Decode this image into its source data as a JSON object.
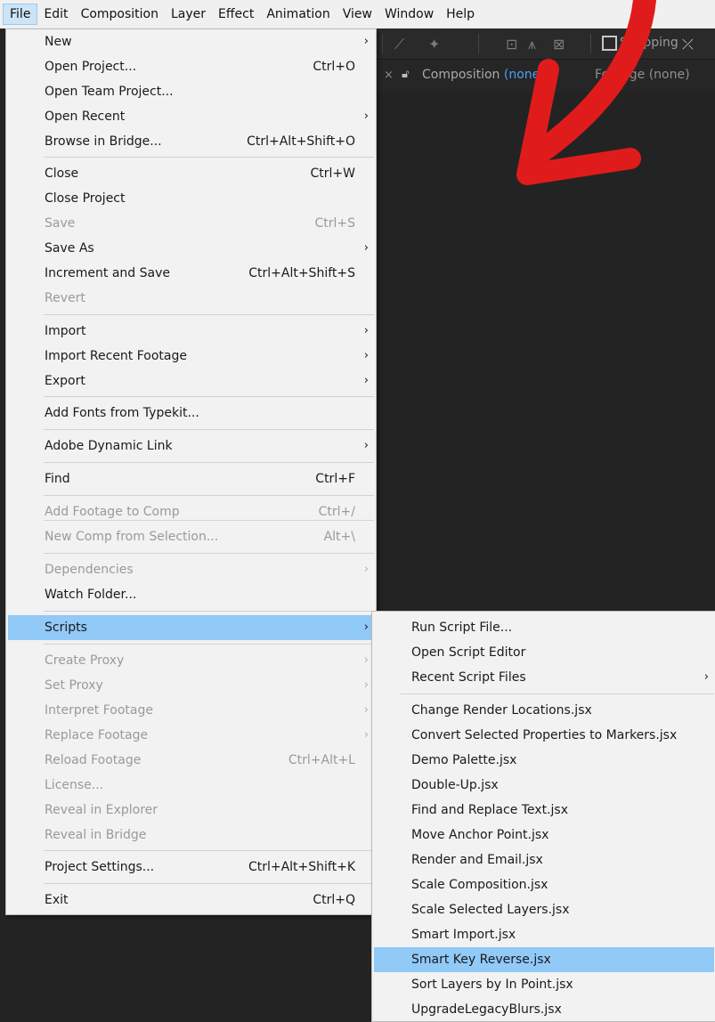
{
  "menubar": {
    "items": [
      "File",
      "Edit",
      "Composition",
      "Layer",
      "Effect",
      "Animation",
      "View",
      "Window",
      "Help"
    ]
  },
  "toolbar": {
    "snapping_label": "Snapping"
  },
  "panel": {
    "composition_tab": "Composition",
    "composition_value": "(none)",
    "footage_tab": "Footage (none)"
  },
  "file_menu": {
    "items": [
      {
        "label": "New",
        "shortcut": "",
        "submenu": true,
        "disabled": false
      },
      {
        "label": "Open Project...",
        "shortcut": "Ctrl+O",
        "submenu": false,
        "disabled": false
      },
      {
        "label": "Open Team Project...",
        "shortcut": "",
        "submenu": false,
        "disabled": false
      },
      {
        "label": "Open Recent",
        "shortcut": "",
        "submenu": true,
        "disabled": false
      },
      {
        "label": "Browse in Bridge...",
        "shortcut": "Ctrl+Alt+Shift+O",
        "submenu": false,
        "disabled": false
      },
      {
        "label": "Close",
        "shortcut": "Ctrl+W",
        "submenu": false,
        "disabled": false
      },
      {
        "label": "Close Project",
        "shortcut": "",
        "submenu": false,
        "disabled": false
      },
      {
        "label": "Save",
        "shortcut": "Ctrl+S",
        "submenu": false,
        "disabled": true
      },
      {
        "label": "Save As",
        "shortcut": "",
        "submenu": true,
        "disabled": false
      },
      {
        "label": "Increment and Save",
        "shortcut": "Ctrl+Alt+Shift+S",
        "submenu": false,
        "disabled": false
      },
      {
        "label": "Revert",
        "shortcut": "",
        "submenu": false,
        "disabled": true
      },
      {
        "label": "Import",
        "shortcut": "",
        "submenu": true,
        "disabled": false
      },
      {
        "label": "Import Recent Footage",
        "shortcut": "",
        "submenu": true,
        "disabled": false
      },
      {
        "label": "Export",
        "shortcut": "",
        "submenu": true,
        "disabled": false
      },
      {
        "label": "Add Fonts from Typekit...",
        "shortcut": "",
        "submenu": false,
        "disabled": false
      },
      {
        "label": "Adobe Dynamic Link",
        "shortcut": "",
        "submenu": true,
        "disabled": false
      },
      {
        "label": "Find",
        "shortcut": "Ctrl+F",
        "submenu": false,
        "disabled": false
      },
      {
        "label": "Add Footage to Comp",
        "shortcut": "Ctrl+/",
        "submenu": false,
        "disabled": true
      },
      {
        "label": "New Comp from Selection...",
        "shortcut": "Alt+\\",
        "submenu": false,
        "disabled": true
      },
      {
        "label": "Dependencies",
        "shortcut": "",
        "submenu": true,
        "disabled": true
      },
      {
        "label": "Watch Folder...",
        "shortcut": "",
        "submenu": false,
        "disabled": false
      },
      {
        "label": "Scripts",
        "shortcut": "",
        "submenu": true,
        "disabled": false,
        "highlighted": true
      },
      {
        "label": "Create Proxy",
        "shortcut": "",
        "submenu": true,
        "disabled": true
      },
      {
        "label": "Set Proxy",
        "shortcut": "",
        "submenu": true,
        "disabled": true
      },
      {
        "label": "Interpret Footage",
        "shortcut": "",
        "submenu": true,
        "disabled": true
      },
      {
        "label": "Replace Footage",
        "shortcut": "",
        "submenu": true,
        "disabled": true
      },
      {
        "label": "Reload Footage",
        "shortcut": "Ctrl+Alt+L",
        "submenu": false,
        "disabled": true
      },
      {
        "label": "License...",
        "shortcut": "",
        "submenu": false,
        "disabled": true
      },
      {
        "label": "Reveal in Explorer",
        "shortcut": "",
        "submenu": false,
        "disabled": true
      },
      {
        "label": "Reveal in Bridge",
        "shortcut": "",
        "submenu": false,
        "disabled": true
      },
      {
        "label": "Project Settings...",
        "shortcut": "Ctrl+Alt+Shift+K",
        "submenu": false,
        "disabled": false
      },
      {
        "label": "Exit",
        "shortcut": "Ctrl+Q",
        "submenu": false,
        "disabled": false
      }
    ]
  },
  "scripts_menu": {
    "items": [
      {
        "label": "Run Script File...",
        "submenu": false
      },
      {
        "label": "Open Script Editor",
        "submenu": false
      },
      {
        "label": "Recent Script Files",
        "submenu": true
      },
      {
        "label": "Change Render Locations.jsx",
        "submenu": false
      },
      {
        "label": "Convert Selected Properties to Markers.jsx",
        "submenu": false
      },
      {
        "label": "Demo Palette.jsx",
        "submenu": false
      },
      {
        "label": "Double-Up.jsx",
        "submenu": false
      },
      {
        "label": "Find and Replace Text.jsx",
        "submenu": false
      },
      {
        "label": "Move Anchor Point.jsx",
        "submenu": false
      },
      {
        "label": "Render and Email.jsx",
        "submenu": false
      },
      {
        "label": "Scale Composition.jsx",
        "submenu": false
      },
      {
        "label": "Scale Selected Layers.jsx",
        "submenu": false
      },
      {
        "label": "Smart Import.jsx",
        "submenu": false
      },
      {
        "label": "Smart Key Reverse.jsx",
        "submenu": false,
        "highlighted": true
      },
      {
        "label": "Sort Layers by In Point.jsx",
        "submenu": false
      },
      {
        "label": "UpgradeLegacyBlurs.jsx",
        "submenu": false
      }
    ]
  },
  "colors": {
    "menu_bg": "#f2f2f2",
    "highlight": "#91c9f7",
    "disabled_text": "#9a9a9a",
    "arrow_red": "#e01b1b",
    "app_bg": "#232323",
    "link_blue": "#4ea1f3"
  }
}
